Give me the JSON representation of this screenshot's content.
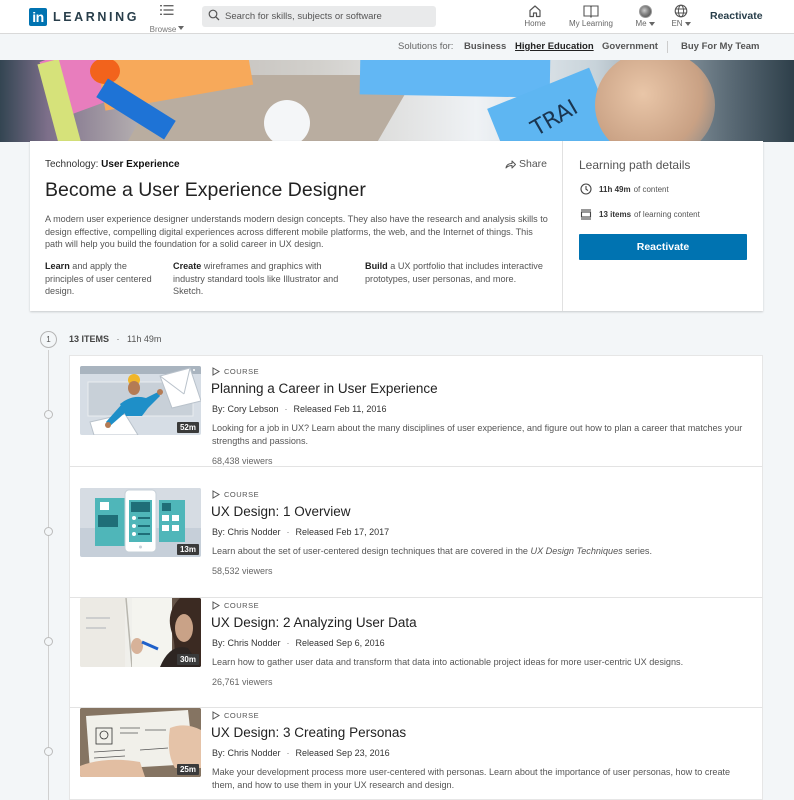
{
  "nav": {
    "logo_in": "in",
    "logo_text": "LEARNING",
    "browse_label": "Browse",
    "search_placeholder": "Search for skills, subjects or software",
    "items": [
      {
        "label": "Home",
        "icon": "home-icon"
      },
      {
        "label": "My Learning",
        "icon": "book-icon"
      },
      {
        "label": "Me",
        "icon": "avatar"
      },
      {
        "label": "EN",
        "icon": "globe-icon"
      }
    ],
    "reactivate": "Reactivate"
  },
  "subnav": {
    "solutions_label": "Solutions for:",
    "links": [
      "Business",
      "Higher Education",
      "Government"
    ],
    "buy": "Buy For My Team"
  },
  "path": {
    "category_prefix": "Technology:",
    "category": "User Experience",
    "share": "Share",
    "title": "Become a User Experience Designer",
    "description": "A modern user experience designer understands modern design concepts. They also have the research and analysis skills to design effective, compelling digital experiences across different mobile platforms, the web, and the Internet of things. This path will help you build the foundation for a solid career in UX design.",
    "goals": [
      {
        "bold": "Learn",
        "text": " and apply the principles of user centered design."
      },
      {
        "bold": "Create",
        "text": " wireframes and graphics with industry standard tools like Illustrator and Sketch."
      },
      {
        "bold": "Build",
        "text": " a UX portfolio that includes interactive prototypes, user personas, and more."
      }
    ]
  },
  "details": {
    "title": "Learning path details",
    "duration_bold": "11h 49m",
    "duration_rest": "of content",
    "items_bold": "13 items",
    "items_rest": "of learning content",
    "button": "Reactivate"
  },
  "section": {
    "step": "1",
    "count": "13 ITEMS",
    "sep": "·",
    "duration": "11h 49m"
  },
  "courses": [
    {
      "type": "COURSE",
      "title": "Planning a Career in User Experience",
      "author": "By: Cory Lebson",
      "released": "Released Feb 11, 2016",
      "description": "Looking for a job in UX? Learn about the many disciplines of user experience, and figure out how to plan a career that matches your strengths and passions.",
      "viewers": "68,438 viewers",
      "duration": "52m"
    },
    {
      "type": "COURSE",
      "title": "UX Design: 1 Overview",
      "author": "By: Chris Nodder",
      "released": "Released Feb 17, 2017",
      "description_pre": "Learn about the set of user-centered design techniques that are covered in the ",
      "description_em": "UX Design Techniques",
      "description_post": " series.",
      "viewers": "58,532 viewers",
      "duration": "13m"
    },
    {
      "type": "COURSE",
      "title": "UX Design: 2 Analyzing User Data",
      "author": "By: Chris Nodder",
      "released": "Released Sep 6, 2016",
      "description": "Learn how to gather user data and transform that data into actionable project ideas for more user-centric UX designs.",
      "viewers": "26,761 viewers",
      "duration": "30m"
    },
    {
      "type": "COURSE",
      "title": "UX Design: 3 Creating Personas",
      "author": "By: Chris Nodder",
      "released": "Released Sep 23, 2016",
      "description": "Make your development process more user-centered with personas. Learn about the importance of user personas, how to create them, and how to use them in your UX research and design.",
      "duration": "25m"
    }
  ],
  "colors": {
    "brand": "#0073b1",
    "background": "#f3f6f8",
    "text": "#283e4a"
  }
}
